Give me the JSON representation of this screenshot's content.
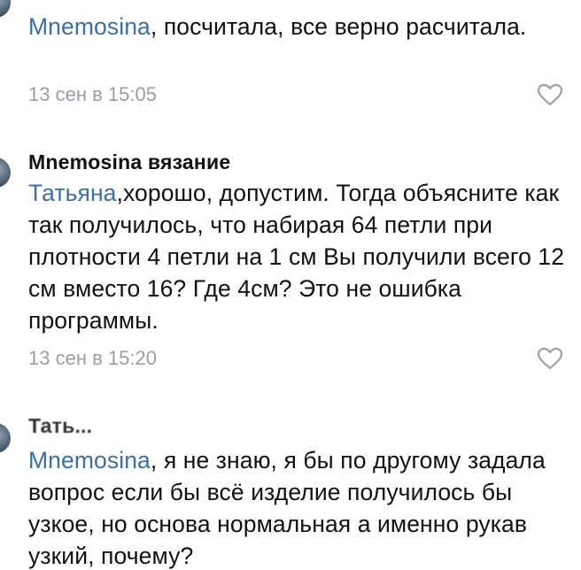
{
  "comments": [
    {
      "author": "",
      "mention": "Mnemosina",
      "text": ", посчитала, все верно расчитала.",
      "timestamp": "13 сен в 15:05",
      "like_icon": "heart-outline-icon"
    },
    {
      "author": "Mnemosina вязание",
      "mention": "Татьяна",
      "text": ",хорошо, допустим. Тогда объясните как так получилось, что набирая 64 петли при плотности 4 петли на 1 см Вы получили всего 12 см вместо 16? Где 4см? Это не ошибка программы.",
      "timestamp": "13 сен в 15:20",
      "like_icon": "heart-outline-icon"
    },
    {
      "author": "Тать...",
      "mention": "Mnemosina",
      "text": ", я не знаю, я бы по другому задала вопрос если бы всё изделие получилось бы узкое, но основа нормальная а именно рукав узкий, почему?",
      "timestamp": "",
      "like_icon": ""
    }
  ],
  "colors": {
    "mention": "#3d6fa6",
    "meta": "#9a9ea3",
    "text": "#111111"
  }
}
